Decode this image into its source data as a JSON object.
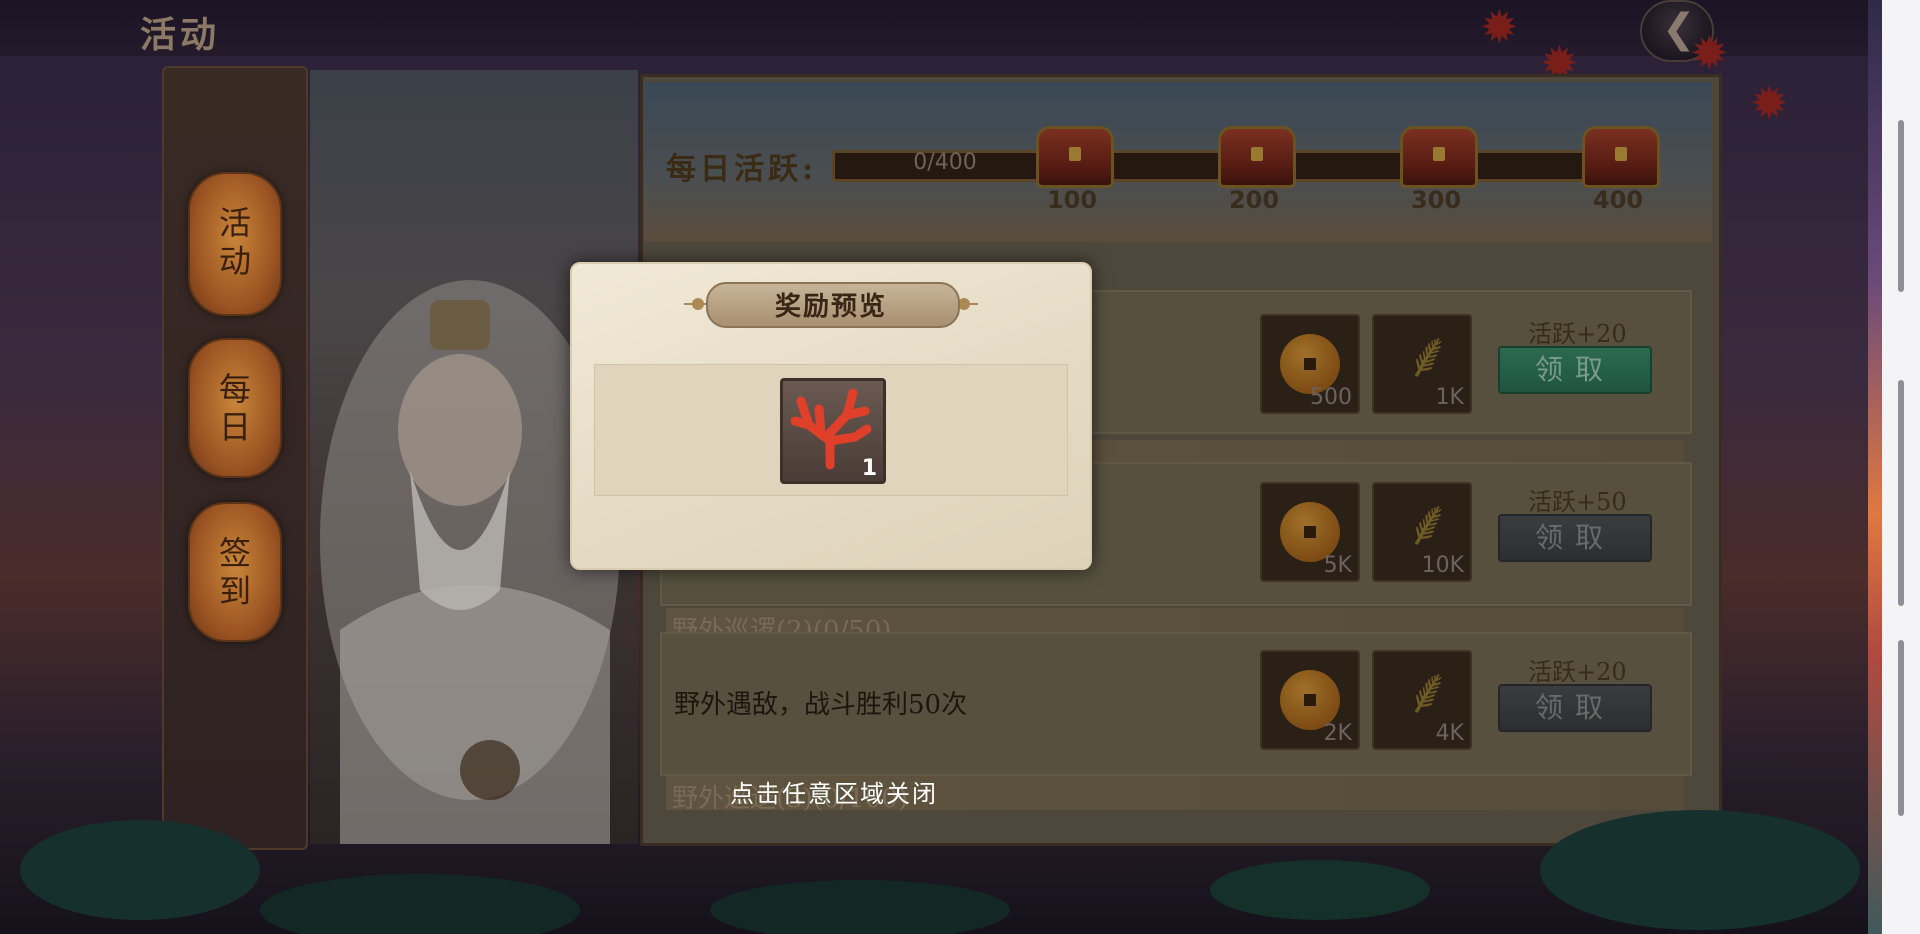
{
  "header": {
    "title": "活动"
  },
  "tabs": [
    {
      "label": "活动"
    },
    {
      "label": "每日"
    },
    {
      "label": "签到"
    }
  ],
  "daily_activity": {
    "label": "每日活跃:",
    "progress_text": "0/400",
    "progress_fraction": 0.0,
    "milestones": [
      "100",
      "200",
      "300",
      "400"
    ]
  },
  "tasks": [
    {
      "rewards": [
        {
          "icon": "coin-icon",
          "qty": "500"
        },
        {
          "icon": "grain-icon",
          "qty": "1K"
        }
      ],
      "activity": "活跃+20",
      "button": "领取"
    },
    {
      "rewards": [
        {
          "icon": "coin-icon",
          "qty": "5K"
        },
        {
          "icon": "grain-icon",
          "qty": "10K"
        }
      ],
      "activity": "活跃+50",
      "button": "领取"
    },
    {
      "title": "野外巡逻(2)(0/50)",
      "desc": "野外遇敌，战斗胜利50次",
      "rewards": [
        {
          "icon": "coin-icon",
          "qty": "2K"
        },
        {
          "icon": "grain-icon",
          "qty": "4K"
        }
      ],
      "activity": "活跃+20",
      "button": "领取"
    },
    {
      "title": "野外巡逻(3)(0/100)"
    }
  ],
  "modal": {
    "title": "奖励预览",
    "item": {
      "icon": "coral-icon",
      "qty": "1"
    },
    "close_hint": "点击任意区域关闭"
  },
  "colors": {
    "active_button": "#2c6a50",
    "inactive_button": "#2c2e32",
    "modal_bg": "#e6dcc6"
  }
}
